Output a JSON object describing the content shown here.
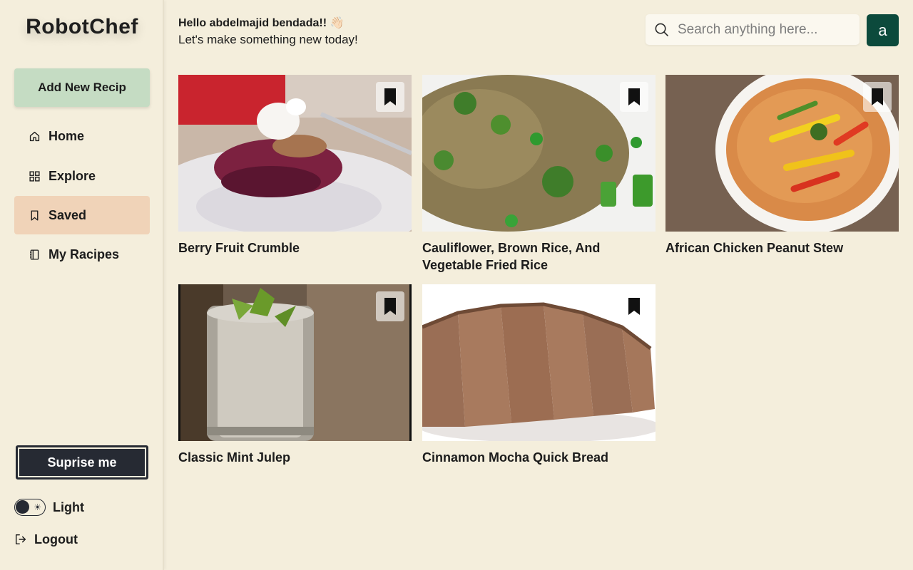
{
  "app": {
    "name": "RobotChef"
  },
  "sidebar": {
    "add_button": "Add New Recip",
    "items": [
      {
        "label": "Home",
        "icon": "home-icon"
      },
      {
        "label": "Explore",
        "icon": "grid-icon"
      },
      {
        "label": "Saved",
        "icon": "bookmark-icon",
        "active": true
      },
      {
        "label": "My Racipes",
        "icon": "notebook-icon"
      }
    ],
    "surprise_button": "Suprise me",
    "theme_label": "Light",
    "logout_label": "Logout"
  },
  "header": {
    "greeting": "Hello abdelmajid bendada!! 👋🏻",
    "subtitle": "Let's make something new today!",
    "search_placeholder": "Search anything here...",
    "avatar_letter": "a"
  },
  "recipes": [
    {
      "title": "Berry Fruit Crumble"
    },
    {
      "title": "Cauliflower, Brown Rice, And Vegetable Fried Rice"
    },
    {
      "title": "African Chicken Peanut Stew"
    },
    {
      "title": "Classic Mint Julep"
    },
    {
      "title": "Cinnamon Mocha Quick Bread"
    }
  ],
  "colors": {
    "background": "#f4eedc",
    "add_button": "#c5dcc3",
    "active_nav": "#f0d3b8",
    "dark_button": "#262a33",
    "avatar": "#0c4a3c"
  }
}
